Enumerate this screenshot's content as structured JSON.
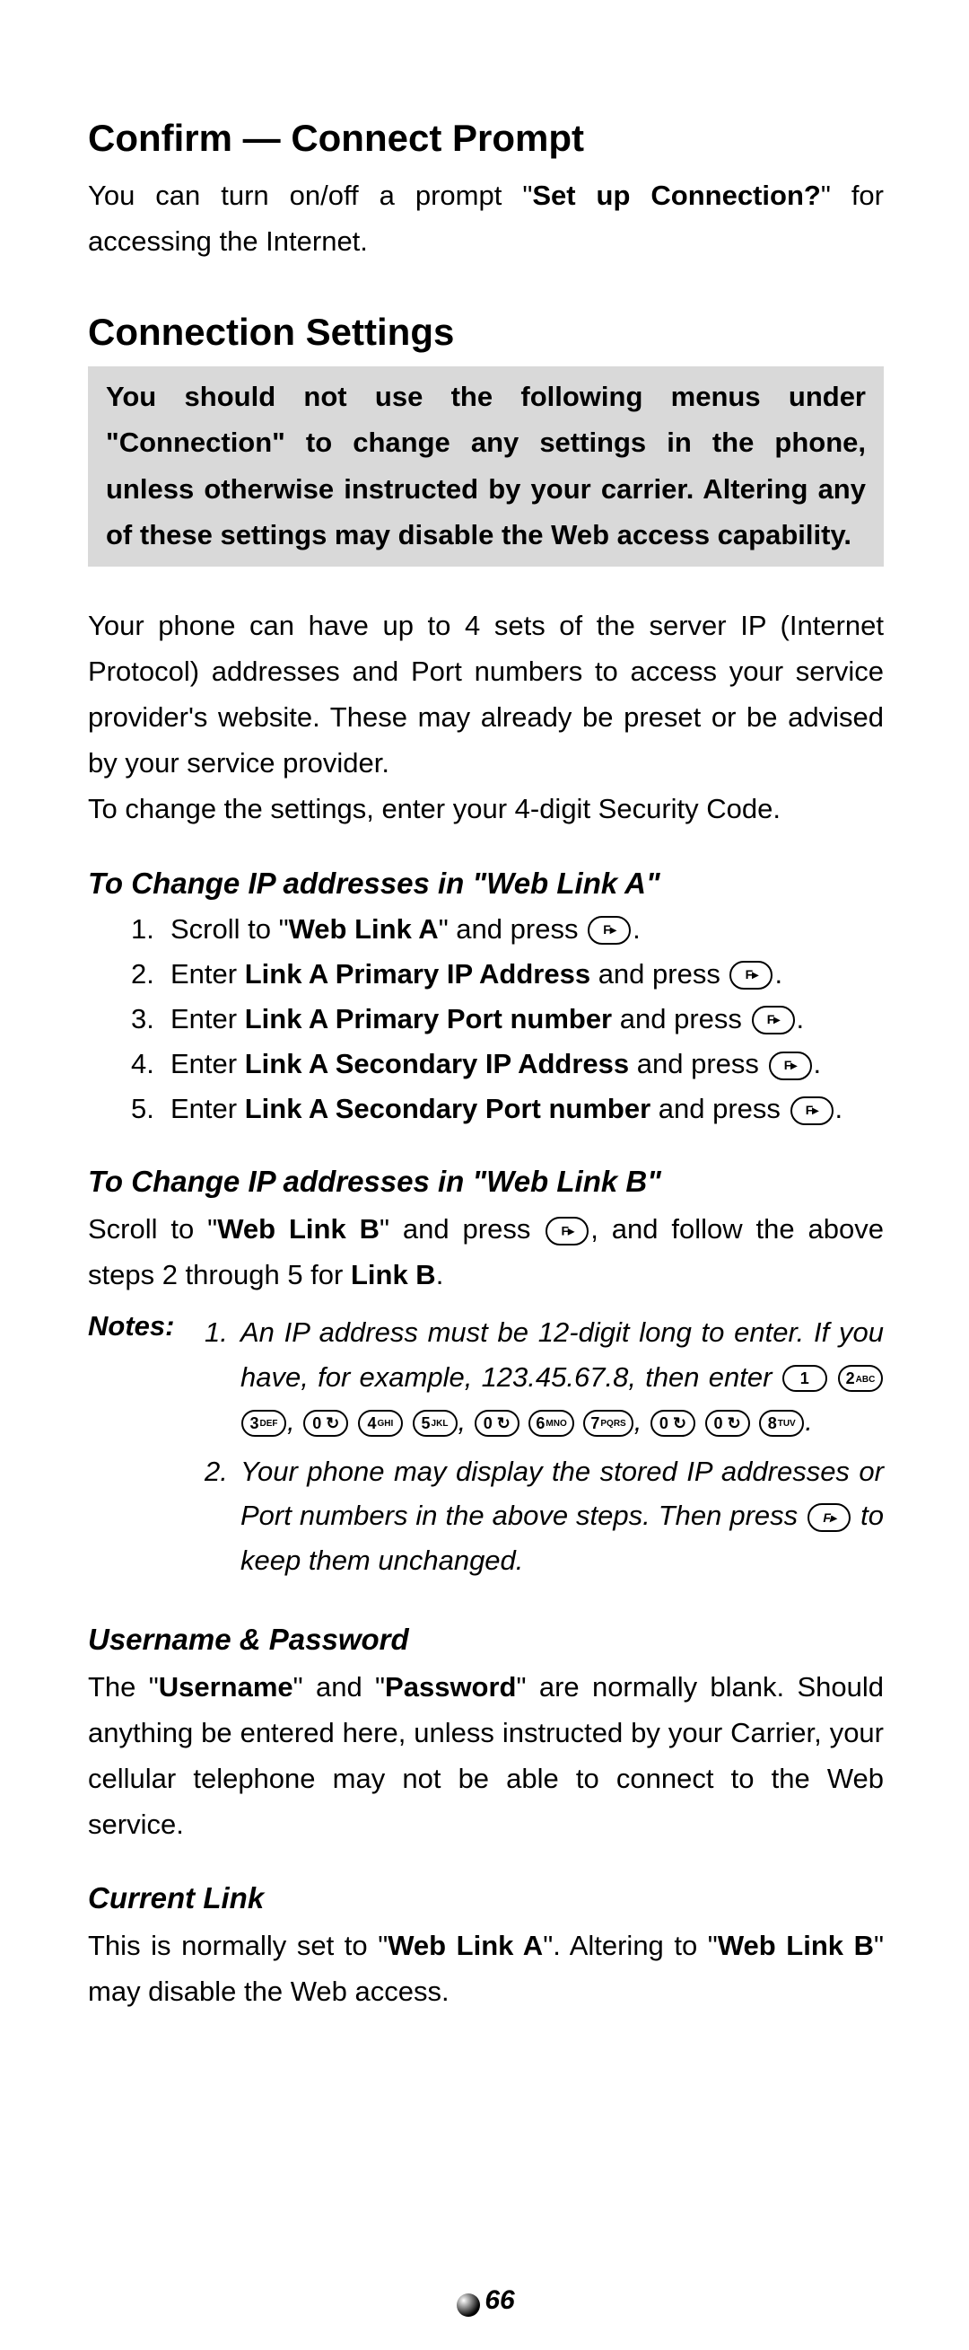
{
  "title1": "Confirm — Connect Prompt",
  "intro_parts": {
    "a": "You can turn on/off a prompt \"",
    "b": "Set up Connection?",
    "c": "\" for accessing the Internet."
  },
  "title2": "Connection Settings",
  "warning": "You should not use the following menus under \"Connection\" to change any settings in the phone, unless otherwise instructed by your carrier. Altering any of these settings may disable the Web access capability.",
  "para2": "Your phone can have up to 4 sets of the server IP (Internet Protocol) addresses and Port numbers to access your service provider's website. These may already be preset or be advised by your service provider.",
  "para3": "To change the settings, enter your 4-digit Security Code.",
  "weblinkA_title": "To Change IP addresses in \"Web Link A\"",
  "steps": [
    {
      "pre": "Scroll to \"",
      "bold": "Web Link A",
      "post": "\" and press "
    },
    {
      "pre": "Enter ",
      "bold": "Link A Primary IP Address",
      "post": " and press "
    },
    {
      "pre": "Enter ",
      "bold": "Link A Primary Port number",
      "post": " and press "
    },
    {
      "pre": "Enter ",
      "bold": "Link A Secondary IP Address",
      "post": " and press "
    },
    {
      "pre": "Enter ",
      "bold": "Link A Secondary Port number",
      "post": " and press "
    }
  ],
  "weblinkB_title": "To Change IP addresses in \"Web Link B\"",
  "linkB": {
    "a": "Scroll to \"",
    "b": "Web Link B",
    "c": "\" and press ",
    "d": ", and follow the above steps 2 through 5 for ",
    "e": "Link B",
    "f": "."
  },
  "notes_label": "Notes:",
  "note1": {
    "a": "An IP address must be 12-digit long to enter. If you have, for example, 123.45.67.8, then enter ",
    "dot": "."
  },
  "keys": {
    "k1": "1",
    "k2": "2",
    "k2s": "ABC",
    "k3": "3",
    "k3s": "DEF",
    "k0": "0",
    "k0s": "↻",
    "k4": "4",
    "k4s": "GHI",
    "k5": "5",
    "k5s": "JKL",
    "k6": "6",
    "k6s": "MNO",
    "k7": "7",
    "k7s": "PQRS",
    "k8": "8",
    "k8s": "TUV",
    "comma": ","
  },
  "note2": {
    "a": "Your phone may display the stored IP addresses or Port numbers in the above steps. Then press ",
    "b": " to keep them unchanged."
  },
  "userpass_title": "Username & Password",
  "userpass": {
    "a": "The \"",
    "b": "Username",
    "c": "\" and \"",
    "d": "Password",
    "e": "\" are normally blank. Should anything be entered here, unless instructed by your Carrier, your cellular telephone may not be able to connect to the Web service."
  },
  "currentlink_title": "Current Link",
  "currentlink": {
    "a": "This is normally set to \"",
    "b": "Web Link A",
    "c": "\". Altering to \"",
    "d": "Web Link B",
    "e": "\" may disable the Web access."
  },
  "page_number": "66"
}
